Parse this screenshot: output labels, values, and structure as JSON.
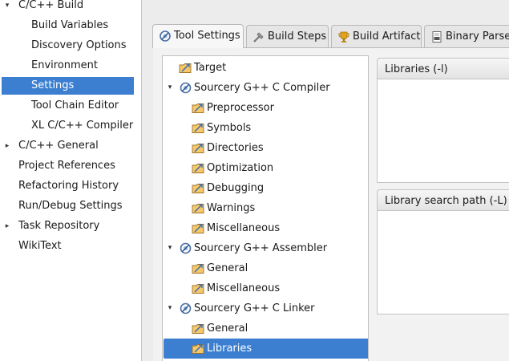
{
  "nav": {
    "items": [
      {
        "label": "C/C++ Build",
        "arrow": "▾"
      },
      {
        "label": "Build Variables"
      },
      {
        "label": "Discovery Options"
      },
      {
        "label": "Environment"
      },
      {
        "label": "Settings"
      },
      {
        "label": "Tool Chain Editor"
      },
      {
        "label": "XL C/C++ Compiler"
      },
      {
        "label": "C/C++ General",
        "arrow": "▸"
      },
      {
        "label": "Project References"
      },
      {
        "label": "Refactoring History"
      },
      {
        "label": "Run/Debug Settings"
      },
      {
        "label": "Task Repository",
        "arrow": "▸"
      },
      {
        "label": "WikiText"
      }
    ]
  },
  "tabs": [
    {
      "label": "Tool Settings",
      "icon": "tool-settings-icon"
    },
    {
      "label": "Build Steps",
      "icon": "build-steps-icon"
    },
    {
      "label": "Build Artifact",
      "icon": "build-artifact-icon"
    },
    {
      "label": "Binary Parser",
      "icon": "binary-parser-icon"
    }
  ],
  "tool_tree": {
    "items": [
      {
        "label": "Target"
      },
      {
        "label": "Sourcery G++ C Compiler",
        "arrow": "▾"
      },
      {
        "label": "Preprocessor"
      },
      {
        "label": "Symbols"
      },
      {
        "label": "Directories"
      },
      {
        "label": "Optimization"
      },
      {
        "label": "Debugging"
      },
      {
        "label": "Warnings"
      },
      {
        "label": "Miscellaneous"
      },
      {
        "label": "Sourcery G++ Assembler",
        "arrow": "▾"
      },
      {
        "label": "General"
      },
      {
        "label": "Miscellaneous"
      },
      {
        "label": "Sourcery G++ C Linker",
        "arrow": "▾"
      },
      {
        "label": "General"
      },
      {
        "label": "Libraries"
      }
    ]
  },
  "panels": {
    "libraries": {
      "title": "Libraries (-l)"
    },
    "library_search_path": {
      "title": "Library search path (-L)"
    }
  },
  "colors": {
    "selection": "#3c7fd1"
  }
}
